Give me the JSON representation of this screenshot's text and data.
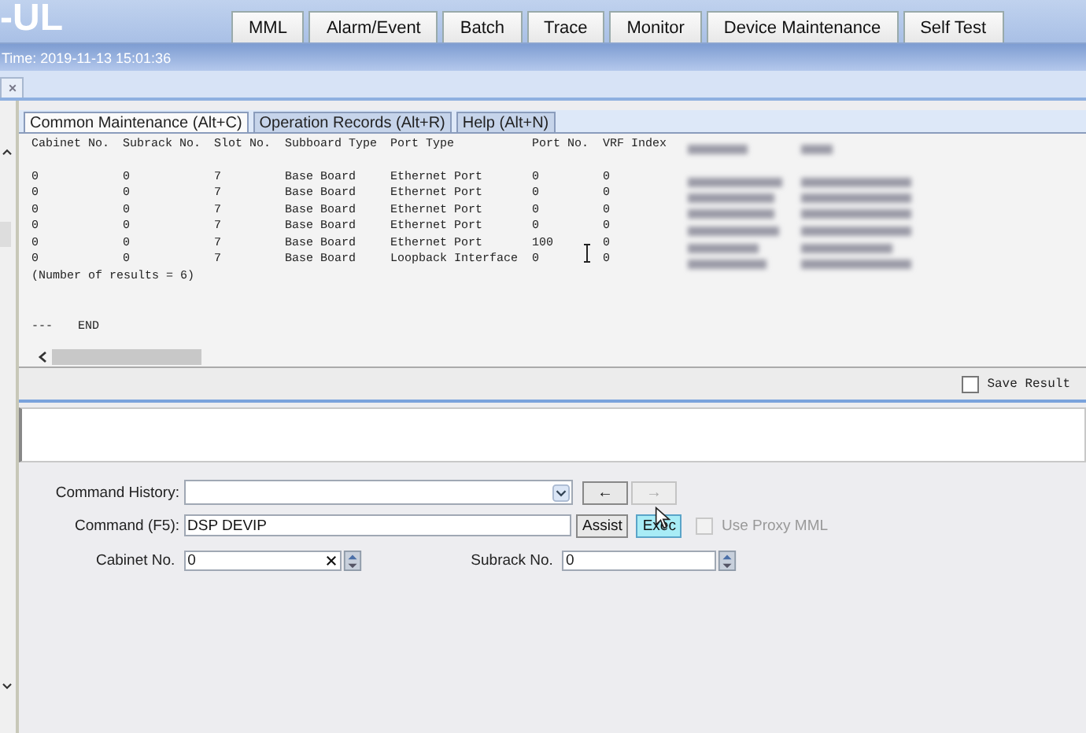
{
  "app_title": "-UL",
  "menu_tabs": [
    {
      "label": "MML"
    },
    {
      "label": "Alarm/Event"
    },
    {
      "label": "Batch"
    },
    {
      "label": "Trace"
    },
    {
      "label": "Monitor"
    },
    {
      "label": "Device Maintenance"
    },
    {
      "label": "Self Test"
    }
  ],
  "time": "Time: 2019-11-13 15:01:36",
  "output_tabs": [
    {
      "label": "Common Maintenance (Alt+C)",
      "selected": true
    },
    {
      "label": "Operation Records (Alt+R)",
      "selected": false
    },
    {
      "label": "Help (Alt+N)",
      "selected": false
    }
  ],
  "results": {
    "columns": [
      "Cabinet No.",
      "Subrack No.",
      "Slot No.",
      "Subboard Type",
      "Port Type",
      "Port No.",
      "VRF Index"
    ],
    "rows": [
      [
        "0",
        "0",
        "7",
        "Base Board",
        "Ethernet Port",
        "0",
        "0"
      ],
      [
        "0",
        "0",
        "7",
        "Base Board",
        "Ethernet Port",
        "0",
        "0"
      ],
      [
        "0",
        "0",
        "7",
        "Base Board",
        "Ethernet Port",
        "0",
        "0"
      ],
      [
        "0",
        "0",
        "7",
        "Base Board",
        "Ethernet Port",
        "0",
        "0"
      ],
      [
        "0",
        "0",
        "7",
        "Base Board",
        "Ethernet Port",
        "100",
        "0"
      ],
      [
        "0",
        "0",
        "7",
        "Base Board",
        "Loopback Interface",
        "0",
        "0"
      ]
    ],
    "summary": "(Number of results = 6)",
    "end_marker": "---",
    "end_label": "END"
  },
  "save_result": {
    "label": "Save Result",
    "checked": false
  },
  "command_history": {
    "label": "Command History:",
    "back": {
      "label": "←",
      "disabled": false
    },
    "forward": {
      "label": "→",
      "disabled": true
    }
  },
  "command": {
    "label": "Command (F5):",
    "value": "DSP DEVIP"
  },
  "buttons": [
    {
      "label": "Assist",
      "highlighted": false
    },
    {
      "label": "Exec",
      "highlighted": true
    }
  ],
  "use_proxy": {
    "label": "Use Proxy MML",
    "checked": false,
    "disabled": true
  },
  "params": [
    {
      "label": "Cabinet No.",
      "value": "0",
      "clearable": true
    },
    {
      "label": "Subrack No.",
      "value": "0",
      "clearable": false
    }
  ]
}
